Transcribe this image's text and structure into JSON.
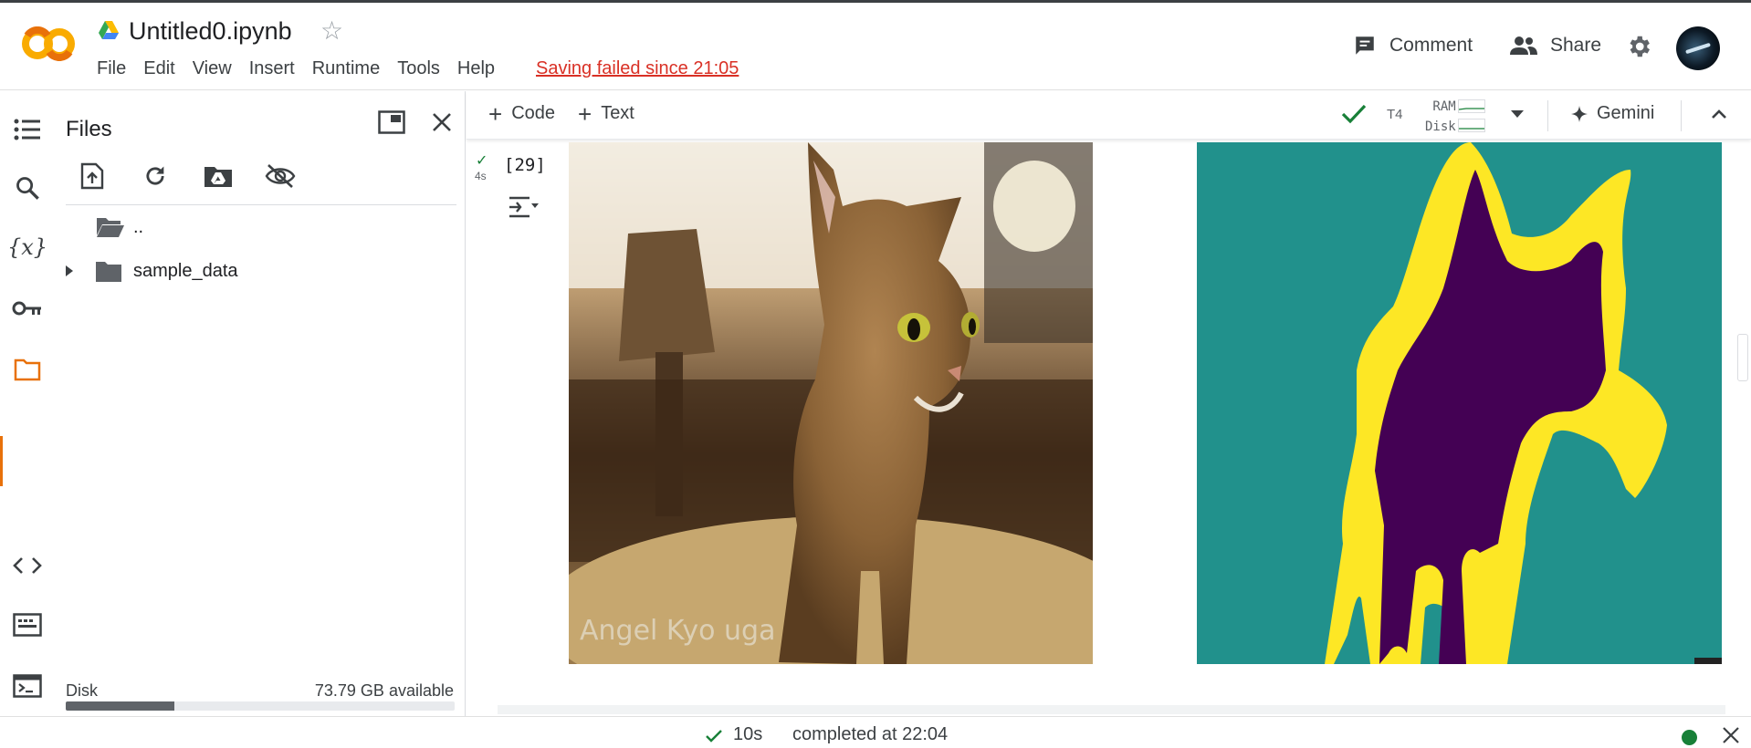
{
  "header": {
    "notebook_title": "Untitled0.ipynb",
    "menu": [
      "File",
      "Edit",
      "View",
      "Insert",
      "Runtime",
      "Tools",
      "Help"
    ],
    "saving_status": "Saving failed since 21:05",
    "comment_label": "Comment",
    "share_label": "Share"
  },
  "files_panel": {
    "title": "Files",
    "tree": [
      {
        "label": "..",
        "type": "parent-folder"
      },
      {
        "label": "sample_data",
        "type": "folder"
      }
    ],
    "disk_label": "Disk",
    "disk_available": "73.79 GB available",
    "disk_used_fraction": 0.28
  },
  "toolbar": {
    "code_label": "Code",
    "text_label": "Text",
    "runtime_type": "T4",
    "ram_label": "RAM",
    "disk_label": "Disk",
    "gemini_label": "Gemini"
  },
  "cell": {
    "exec_count": "[29]",
    "exec_time": "4s"
  },
  "status": {
    "duration": "10s",
    "completed": "completed at 22:04"
  },
  "colors": {
    "accent_orange": "#e8710a",
    "success_green": "#188038",
    "error_red": "#d93025",
    "mask_background": "#21918c",
    "mask_boundary": "#fde725",
    "mask_foreground": "#440154"
  }
}
